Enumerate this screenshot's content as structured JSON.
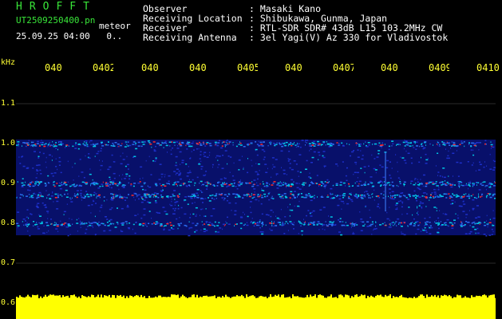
{
  "header": {
    "brand": "HROFFT",
    "filename": "UT2509250400.pn",
    "kind": "meteor",
    "datetime": "25.09.25 04:00",
    "counter": "0..",
    "info": [
      {
        "label": "Observer",
        "value": ": Masaki Kano"
      },
      {
        "label": "Receiving Location",
        "value": ": Shibukawa, Gunma, Japan"
      },
      {
        "label": "Receiver",
        "value": ": RTL-SDR SDR# 43dB L15 103.2MHz CW"
      },
      {
        "label": "Receiving Antenna",
        "value": ": 3el Yagi(V) Az 330 for Vladivostok"
      }
    ]
  },
  "axis": {
    "unit": "kHz",
    "y_ticks": [
      "1.1",
      "1.0",
      "0.9",
      "0.8",
      "0.7",
      "0.6"
    ],
    "x_ticks": [
      "040",
      "0402",
      "040",
      "040",
      "0405",
      "040",
      "0407",
      "040",
      "0409",
      "0410"
    ]
  },
  "spectrogram": {
    "y_range_khz": [
      0.6,
      1.15
    ],
    "band_khz": [
      0.77,
      1.01
    ],
    "strong_lines_khz": [
      1.0,
      0.9,
      0.87,
      0.8
    ],
    "colors": {
      "background": "#000000",
      "noise": "#1c2fc8",
      "mid": "#00c8e6",
      "hot": "#ff2a2a",
      "power": "#ffff00",
      "grid": "#555555"
    }
  }
}
